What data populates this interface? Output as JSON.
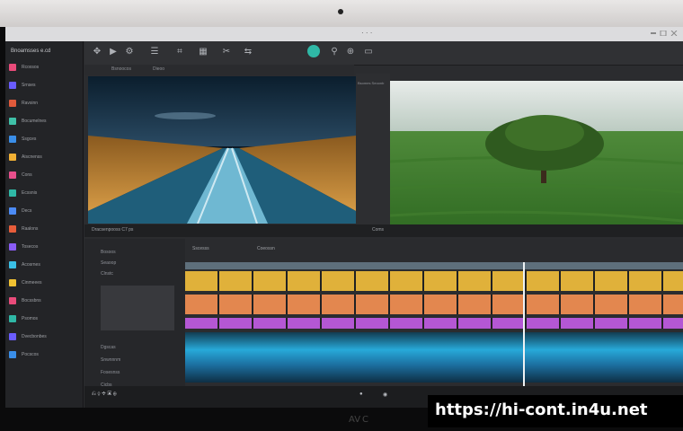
{
  "window": {
    "title": "· · ·"
  },
  "sidebar": {
    "header": "Bnoamsses  e.cd",
    "items": [
      {
        "label": "Rcoxsos",
        "color": "#e94b7a"
      },
      {
        "label": "Srnses",
        "color": "#6a5cff"
      },
      {
        "label": "Ravsinn",
        "color": "#e05a3b"
      },
      {
        "label": "Bocumelnes",
        "color": "#3fc1a8"
      },
      {
        "label": "Ssgces",
        "color": "#3a8ee8"
      },
      {
        "label": "Aiscnenss",
        "color": "#f2b134"
      },
      {
        "label": "Cons",
        "color": "#e84f8c"
      },
      {
        "label": "Ecssnis",
        "color": "#2fb8a6"
      },
      {
        "label": "Decs",
        "color": "#4c8bf5"
      },
      {
        "label": "Raalons",
        "color": "#e85d3a"
      },
      {
        "label": "Tosecos",
        "color": "#8a5cf6"
      },
      {
        "label": "Acosrnes",
        "color": "#3ac0e6"
      },
      {
        "label": "Cinmeees",
        "color": "#f1c232"
      },
      {
        "label": "Bocssbns",
        "color": "#e94b7a"
      },
      {
        "label": "Psomos",
        "color": "#2fb8a6"
      },
      {
        "label": "Dvecbonbes",
        "color": "#6a5cff"
      },
      {
        "label": "Pocscos",
        "color": "#3a8ee8"
      }
    ]
  },
  "panel_tabs": [
    "Bsnoocos",
    "Dieoo"
  ],
  "viewer": {
    "middle_label": "Bsomes Seoonb",
    "bar_left": "Dracsenpooss  C7  ps",
    "bar_right": "Coms"
  },
  "timeline": {
    "header_left": "Sscesss",
    "header_mid": "Coeossn",
    "panel_rows": [
      "Bosoos",
      "Seaoop",
      "Clnstc",
      "Dgscas",
      "Snwnnnm",
      "Fosesnss",
      "Cicbs"
    ],
    "tracks": [
      {
        "name": "video-1",
        "color": "#e0b13a"
      },
      {
        "name": "video-2",
        "color": "#e3874f"
      },
      {
        "name": "video-3",
        "color": "#b457d4"
      },
      {
        "name": "audio-1",
        "color": "#27a9d9"
      }
    ]
  },
  "watermark": "https://hi-cont.in4u.net",
  "brand": "AV C"
}
